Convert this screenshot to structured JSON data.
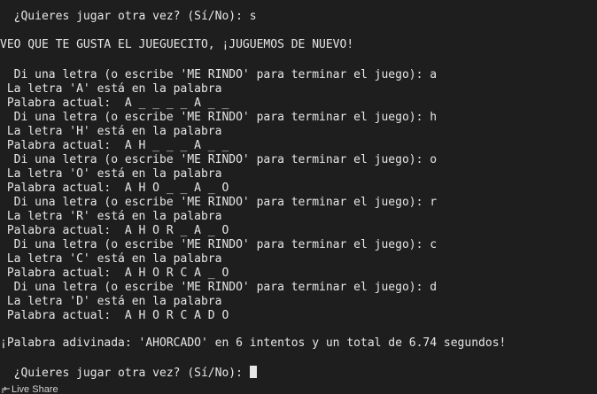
{
  "terminal": {
    "lines": [
      "  ¿Quieres jugar otra vez? (Sí/No): s",
      "",
      "VEO QUE TE GUSTA EL JUEGUECITO, ¡JUGUEMOS DE NUEVO!",
      "",
      "  Di una letra (o escribe 'ME RINDO' para terminar el juego): a",
      " La letra 'A' está en la palabra",
      " Palabra actual:  A _ _ _ _ A _ _",
      "  Di una letra (o escribe 'ME RINDO' para terminar el juego): h",
      " La letra 'H' está en la palabra",
      " Palabra actual:  A H _ _ _ A _ _",
      "  Di una letra (o escribe 'ME RINDO' para terminar el juego): o",
      " La letra 'O' está en la palabra",
      " Palabra actual:  A H O _ _ A _ O",
      "  Di una letra (o escribe 'ME RINDO' para terminar el juego): r",
      " La letra 'R' está en la palabra",
      " Palabra actual:  A H O R _ A _ O",
      "  Di una letra (o escribe 'ME RINDO' para terminar el juego): c",
      " La letra 'C' está en la palabra",
      " Palabra actual:  A H O R C A _ O",
      "  Di una letra (o escribe 'ME RINDO' para terminar el juego): d",
      " La letra 'D' está en la palabra",
      " Palabra actual:  A H O R C A D O",
      "",
      "¡Palabra adivinada: 'AHORCADO' en 6 intentos y un total de 6.74 segundos!",
      ""
    ],
    "prompt": "  ¿Quieres jugar otra vez? (Sí/No): "
  },
  "statusbar": {
    "live_share_label": "Live Share",
    "live_share_icon": "live-share-icon"
  },
  "colors": {
    "background": "#1e1e1e",
    "text": "#e6e6e6"
  }
}
